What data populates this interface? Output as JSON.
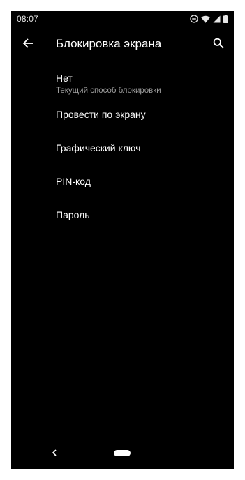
{
  "status_bar": {
    "time": "08:07",
    "icons": [
      "do-not-disturb-icon",
      "wifi-icon",
      "signal-icon",
      "battery-icon"
    ]
  },
  "app_bar": {
    "title": "Блокировка экрана",
    "back_icon": "arrow-back-icon",
    "search_icon": "search-icon"
  },
  "options": [
    {
      "title": "Нет",
      "subtitle": "Текущий способ блокировки"
    },
    {
      "title": "Провести по экрану"
    },
    {
      "title": "Графический ключ"
    },
    {
      "title": "PIN-код"
    },
    {
      "title": "Пароль"
    }
  ],
  "nav_bar": {
    "back_icon": "nav-back-icon",
    "home_icon": "home-pill-icon"
  },
  "colors": {
    "background": "#000000",
    "text_primary": "#ffffff",
    "text_secondary": "#9e9e9e",
    "frame": "#ffffff"
  }
}
